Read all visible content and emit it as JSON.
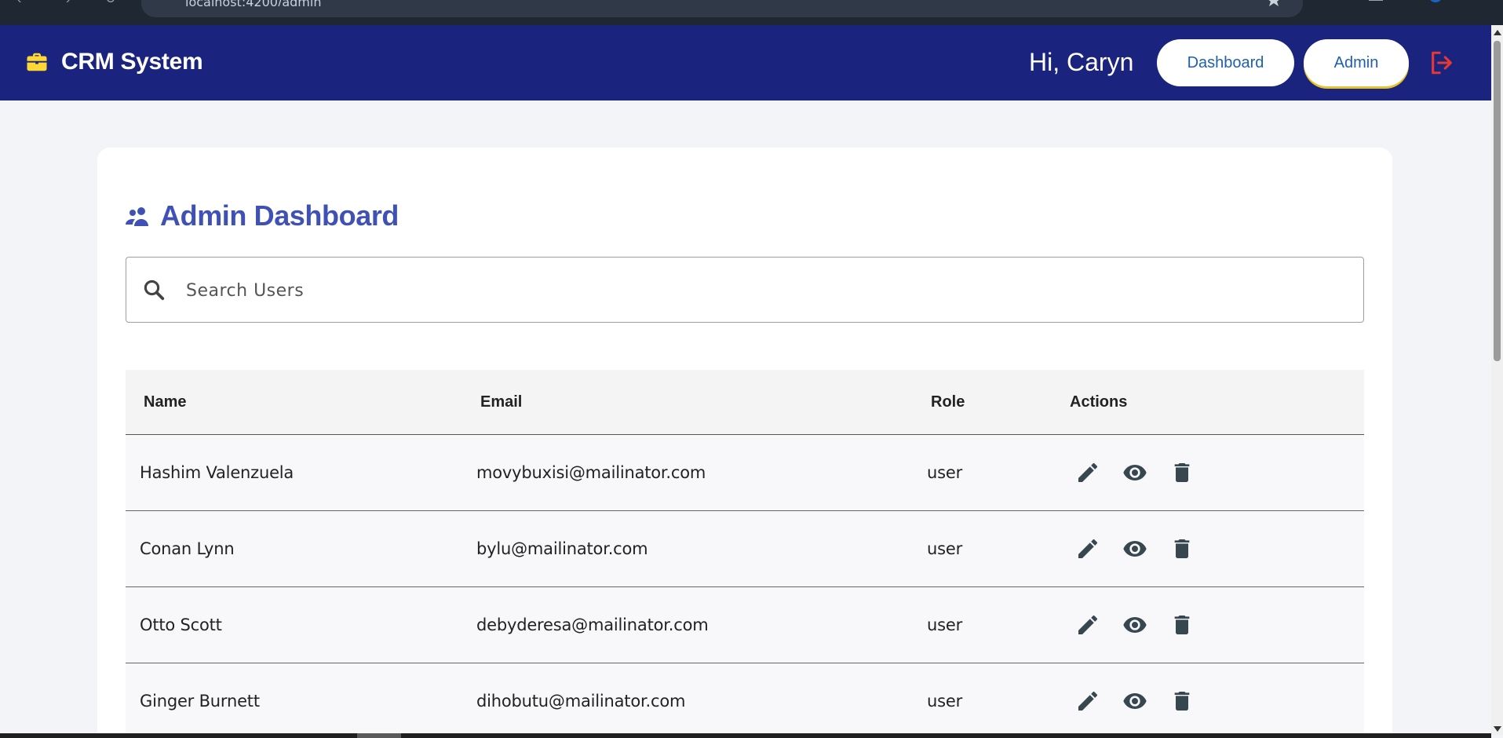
{
  "browser": {
    "address": "localhost:4200/admin"
  },
  "header": {
    "app_title": "CRM System",
    "greeting": "Hi, Caryn",
    "nav": [
      {
        "label": "Dashboard"
      },
      {
        "label": "Admin"
      }
    ],
    "icons": {
      "brand": "briefcase-icon",
      "logout": "logout-icon"
    },
    "colors": {
      "background": "#1a237e",
      "brand_icon": "#fdd835",
      "logout_icon": "#e53935",
      "admin_underline": "#e8c22c"
    }
  },
  "main": {
    "title": "Admin Dashboard",
    "title_icon": "group-icon",
    "title_color": "#3f51b5",
    "search": {
      "placeholder": "Search Users",
      "value": ""
    },
    "table": {
      "columns": [
        "Name",
        "Email",
        "Role",
        "Actions"
      ],
      "rows": [
        {
          "name": "Hashim Valenzuela",
          "email": "movybuxisi@mailinator.com",
          "role": "user"
        },
        {
          "name": "Conan Lynn",
          "email": "bylu@mailinator.com",
          "role": "user"
        },
        {
          "name": "Otto Scott",
          "email": "debyderesa@mailinator.com",
          "role": "user"
        },
        {
          "name": "Ginger Burnett",
          "email": "dihobutu@mailinator.com",
          "role": "user"
        }
      ],
      "row_actions": [
        "edit-icon",
        "view-icon",
        "delete-icon"
      ]
    }
  }
}
